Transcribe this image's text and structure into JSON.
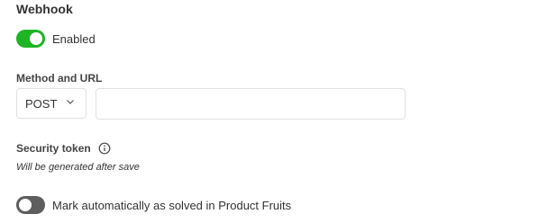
{
  "section": {
    "title": "Webhook"
  },
  "enabled_toggle": {
    "label": "Enabled",
    "state": "on"
  },
  "method_url": {
    "label": "Method and URL",
    "method_value": "POST",
    "url_value": "",
    "url_placeholder": ""
  },
  "security_token": {
    "label": "Security token",
    "hint": "Will be generated after save",
    "icon": "info-icon"
  },
  "auto_solve_toggle": {
    "label": "Mark automatically as solved in Product Fruits",
    "state": "off"
  },
  "colors": {
    "toggle_on": "#1fb426",
    "toggle_off": "#5e5e5e",
    "border": "#e1e1e1"
  }
}
